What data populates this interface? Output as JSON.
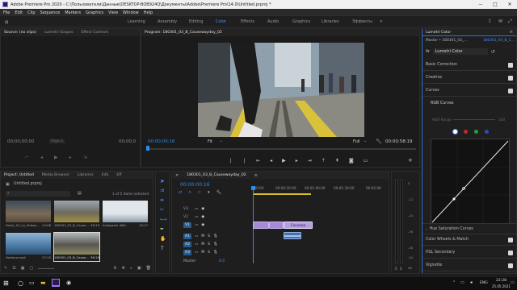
{
  "titlebar": {
    "title": "Adobe Premiere Pro 2020 - C:\\Пользователи\\Данные\\DESKTOP-BOB924Q\\Документы\\Adobe\\Premiere Pro\\14.0\\Untitled.prproj *",
    "minimize": "—",
    "maximize": "□",
    "close": "✕"
  },
  "menubar": {
    "items": [
      "File",
      "Edit",
      "Clip",
      "Sequence",
      "Markers",
      "Graphics",
      "View",
      "Window",
      "Help"
    ]
  },
  "workspaces": {
    "items": [
      "Learning",
      "Assembly",
      "Editing",
      "Color",
      "Effects",
      "Audio",
      "Graphics",
      "Libraries",
      "Эффекты"
    ],
    "active": "Color",
    "more": "»"
  },
  "source": {
    "tabs": [
      "Source: (no clips)",
      "Lumetri Scopes",
      "Effect Controls"
    ],
    "timecode_left": "00;00;00;00",
    "timecode_right": "00;00;0",
    "page": "Page 1"
  },
  "program": {
    "title": "Program: 180301_03_B_Causewayday_02",
    "timecode_current": "00:00:00:16",
    "fit": "Fit",
    "quality": "Full",
    "timecode_duration": "00:00:58:19"
  },
  "project": {
    "tabs": [
      "Project: Untitled",
      "Media Browser",
      "Libraries",
      "Info",
      "Eff"
    ],
    "file": "Untitled.prproj",
    "selected_count": "1 of 5 items selected",
    "items": [
      {
        "name": "Finish_01_Lo_Videos...",
        "duration": "14:08",
        "thumb": "city"
      },
      {
        "name": "180301_03_B_Cause...",
        "duration": "58:19",
        "thumb": "street"
      },
      {
        "name": "Instagram 4K6...",
        "duration": "10:17",
        "thumb": "sky"
      },
      {
        "name": "",
        "duration": "",
        "thumb": "water"
      },
      {
        "name": "Harbour.mp4",
        "duration": "17:10",
        "thumb": "harbour"
      },
      {
        "name": "180301_03_B_Cause...",
        "duration": "36:19",
        "thumb": "street2"
      }
    ]
  },
  "timeline": {
    "title": "180301_03_B_Causewayday_02",
    "timecode": "00:00:00:16",
    "ruler": [
      ":00:00",
      "00:00:30:00",
      "00:01:00:00",
      "00:01:30:00",
      "00:02:00"
    ],
    "video_tracks": [
      "V3",
      "V2",
      "V1"
    ],
    "audio_tracks": [
      "A1",
      "A2",
      "A3"
    ],
    "master_label": "Master",
    "master_value": "0.0",
    "meter_scale": [
      "0",
      "-12",
      "-24",
      "-36",
      "-48",
      "-54"
    ],
    "meter_unit": "dB",
    "clip_label": "Causewa"
  },
  "lumetri": {
    "title": "Lumetri Color",
    "master": "Master • 180301_03_...",
    "clip": "180301_03_B_C...",
    "fx_label": "fx",
    "effect": "Lumetri Color",
    "sections": [
      "Basic Correction",
      "Creative",
      "Curves"
    ],
    "subsection": "RGB Curves",
    "hdr_label": "HDR Range",
    "hdr_value": "100",
    "channels": [
      {
        "name": "white",
        "color": "#ffffff"
      },
      {
        "name": "red",
        "color": "#c0282a"
      },
      {
        "name": "green",
        "color": "#2a9a3a"
      },
      {
        "name": "blue",
        "color": "#2a4cc0"
      }
    ],
    "sections_bottom": [
      "Hue Saturation Curves",
      "Color Wheels & Match",
      "HSL Secondary",
      "Vignette"
    ]
  },
  "taskbar": {
    "lang": "ENG",
    "time": "22:28",
    "date": "25.05.2021",
    "apps": [
      "start",
      "search",
      "task-view",
      "files",
      "edge",
      "store",
      "premiere",
      "media"
    ]
  },
  "colors": {
    "accent": "#4a90ff",
    "program_blue": "#2d8ceb",
    "clip_purple": "#a48bd6",
    "clip_audio": "#4a6ea8"
  }
}
